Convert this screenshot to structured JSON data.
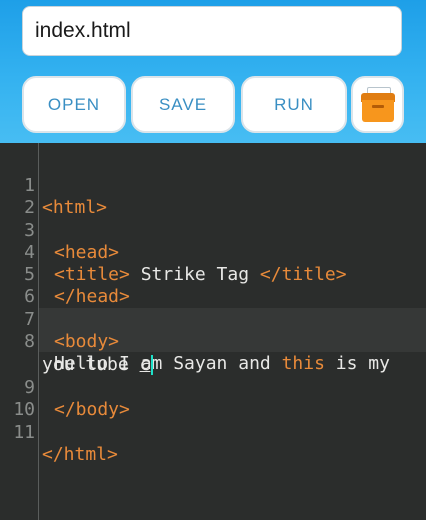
{
  "file": {
    "name": "index.html"
  },
  "toolbar": {
    "open_label": "OPEN",
    "save_label": "SAVE",
    "run_label": "RUN",
    "box_icon": "file-box-icon"
  },
  "editor": {
    "lines": [
      {
        "n": "1",
        "tag": "<html>"
      },
      {
        "n": "2"
      },
      {
        "n": "3",
        "tag": "<head>"
      },
      {
        "n": "4",
        "open": "<title>",
        "text": " Strike Tag ",
        "close": "</title>"
      },
      {
        "n": "5",
        "tag": "</head>"
      },
      {
        "n": "6"
      },
      {
        "n": "7",
        "tag": "<body>"
      },
      {
        "n": "8",
        "a": "Hello I am Sayan and ",
        "kw": "this",
        "b": " is my",
        "wrap": "you tube ",
        "wrap_ul": "c"
      },
      {
        "n": "9",
        "tag": "</body>"
      },
      {
        "n": "10"
      },
      {
        "n": "11",
        "tag": "</html>"
      }
    ]
  },
  "colors": {
    "header_blue": "#1e9fe8",
    "tag_orange": "#e88a3a",
    "editor_bg": "#2b2d2c",
    "cursor": "#1ee0c8"
  }
}
